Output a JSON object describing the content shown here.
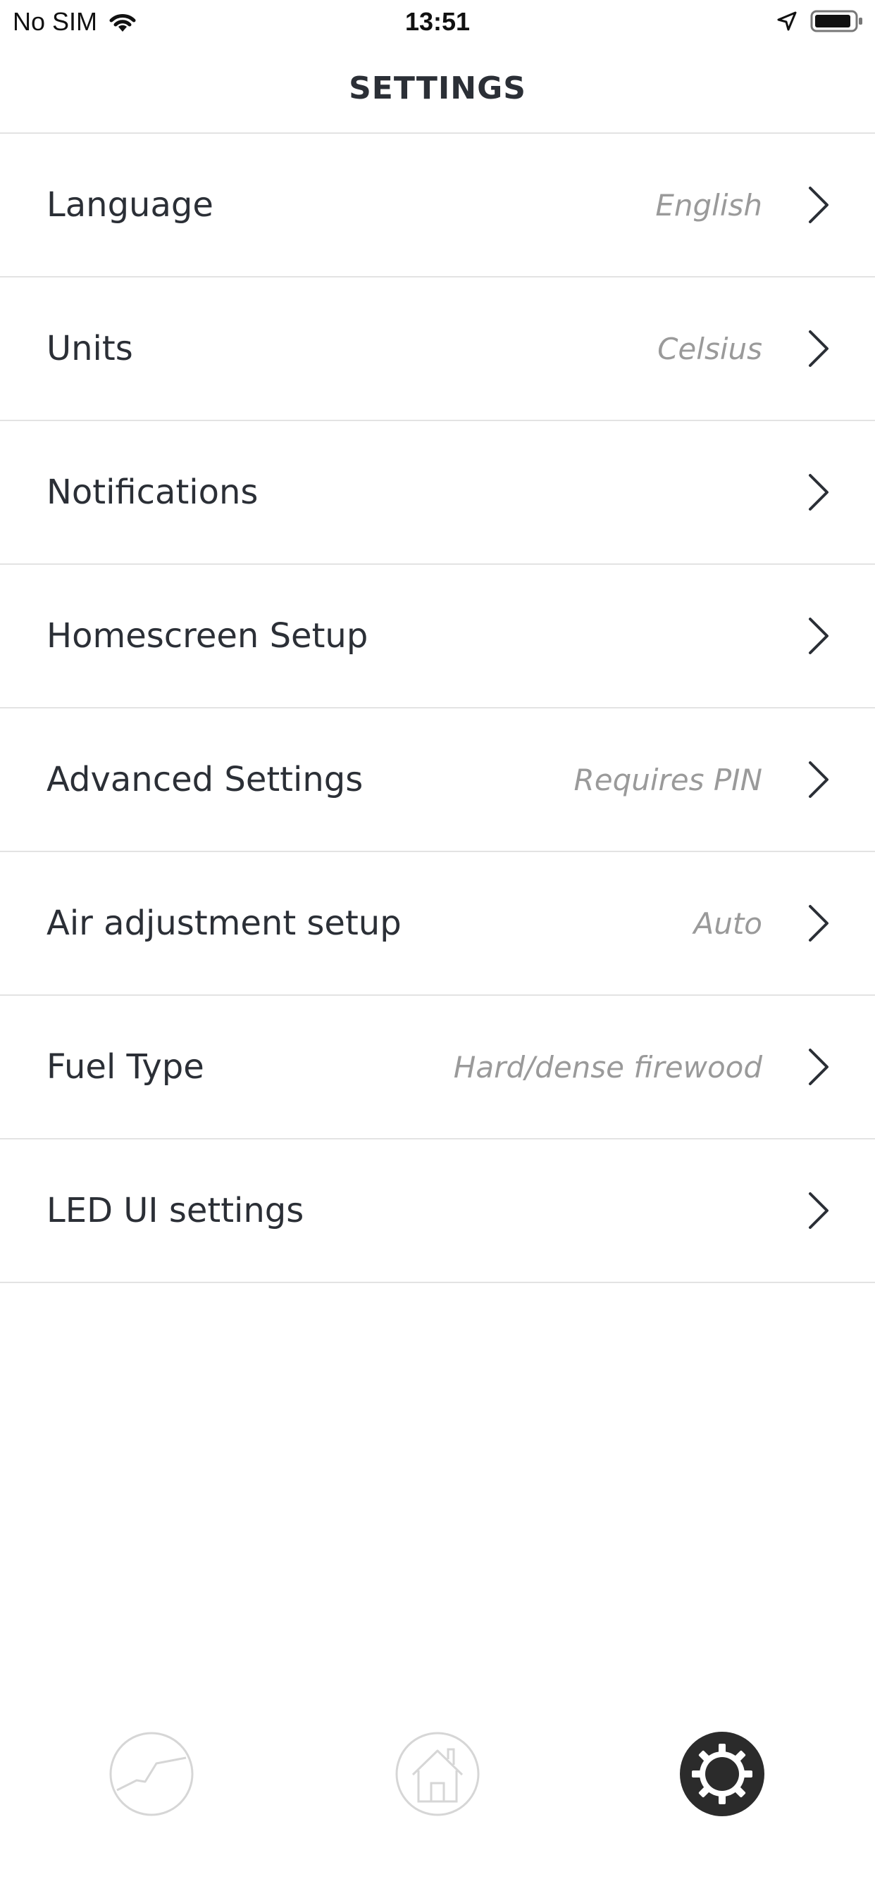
{
  "status_bar": {
    "carrier": "No SIM",
    "time": "13:51"
  },
  "header": {
    "title": "SETTINGS"
  },
  "settings": [
    {
      "label": "Language",
      "value": "English"
    },
    {
      "label": "Units",
      "value": "Celsius"
    },
    {
      "label": "Notifications",
      "value": ""
    },
    {
      "label": "Homescreen Setup",
      "value": ""
    },
    {
      "label": "Advanced Settings",
      "value": "Requires PIN"
    },
    {
      "label": "Air adjustment setup",
      "value": "Auto"
    },
    {
      "label": "Fuel Type",
      "value": "Hard/dense firewood"
    },
    {
      "label": "LED UI settings",
      "value": ""
    }
  ],
  "tab_bar": {
    "tabs": [
      {
        "icon": "chart-icon",
        "active": false
      },
      {
        "icon": "home-icon",
        "active": false
      },
      {
        "icon": "gear-icon",
        "active": true
      }
    ]
  },
  "colors": {
    "text": "#2b2f36",
    "secondary_text": "#9a9a9a",
    "divider": "#e3e3e3",
    "inactive_icon": "#d6d6d6",
    "active_icon": "#2b2b2b"
  }
}
